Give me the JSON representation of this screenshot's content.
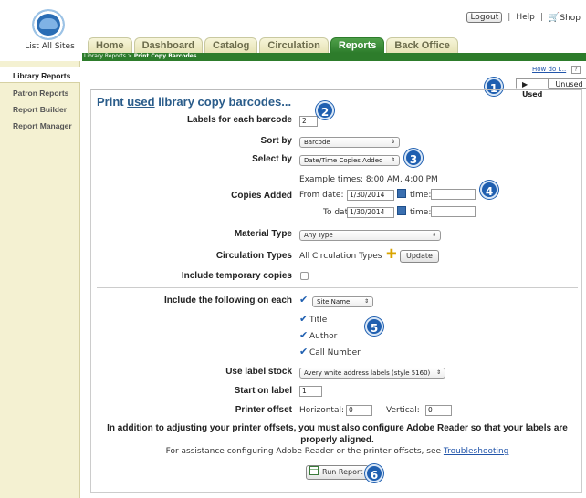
{
  "header": {
    "list_sites": "List All Sites",
    "logout": "Logout",
    "help": "Help",
    "shop": "Shop"
  },
  "tabs": [
    "Home",
    "Dashboard",
    "Catalog",
    "Circulation",
    "Reports",
    "Back Office"
  ],
  "breadcrumb": {
    "part1": "Library Reports > ",
    "part2": "Print Copy Barcodes"
  },
  "sidebar": [
    "Library Reports",
    "Patron Reports",
    "Report Builder",
    "Report Manager"
  ],
  "howdo": "How do I...",
  "help_icon": "?",
  "subtabs": {
    "used": "Used",
    "unused": "Unused"
  },
  "form": {
    "title_pre": "Print ",
    "title_used": "used",
    "title_post": " library copy barcodes...",
    "labels_each": "Labels for each barcode",
    "labels_value": "2",
    "sort_by": "Sort by",
    "sort_value": "Barcode",
    "select_by": "Select by",
    "select_value": "Date/Time Copies Added",
    "example_times": "Example times: 8:00 AM, 4:00 PM",
    "copies_added": "Copies Added",
    "from_date_label": "From date:",
    "from_date": "1/30/2014",
    "to_date_label": "To date:",
    "to_date": "1/30/2014",
    "time_label": "time:",
    "material_type": "Material Type",
    "material_value": "Any Type",
    "circ_types": "Circulation Types",
    "circ_value": "All Circulation Types",
    "update": "Update",
    "include_temp": "Include temporary copies",
    "include_following": "Include the following on each",
    "site_name": "Site Name",
    "title_opt": "Title",
    "author_opt": "Author",
    "call_number_opt": "Call Number",
    "use_label_stock": "Use label stock",
    "label_stock_value": "Avery white address labels (style 5160)",
    "start_on_label": "Start on label",
    "start_value": "1",
    "printer_offset": "Printer offset",
    "horizontal": "Horizontal:",
    "horizontal_value": "0",
    "vertical": "Vertical:",
    "vertical_value": "0",
    "note": "In addition to adjusting your printer offsets, you must also configure Adobe Reader so that your labels are properly aligned.",
    "help_pre": "For assistance configuring Adobe Reader or the printer offsets, see ",
    "help_link": "Troubleshooting",
    "run_report": "Run Report"
  },
  "badges": [
    "1",
    "2",
    "3",
    "4",
    "5",
    "6"
  ]
}
